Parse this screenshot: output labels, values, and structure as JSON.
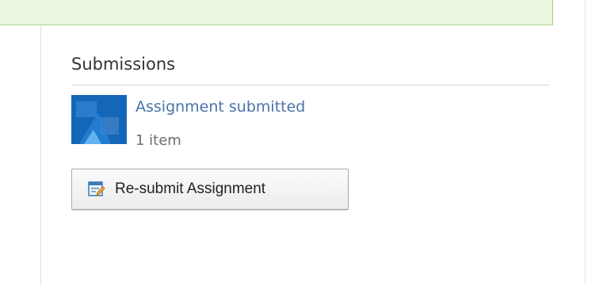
{
  "submissions": {
    "title": "Submissions",
    "items": [
      {
        "link_text": "Assignment submitted",
        "count_text": "1 item",
        "thumbnail_icon": "document-thumbnail"
      }
    ],
    "resubmit_button": {
      "label": "Re-submit Assignment",
      "icon": "edit-form-icon"
    }
  },
  "colors": {
    "banner_bg": "#eaf7df",
    "banner_border": "#a9d28a",
    "link": "#4a72a8",
    "thumbnail": "#1467b8"
  }
}
